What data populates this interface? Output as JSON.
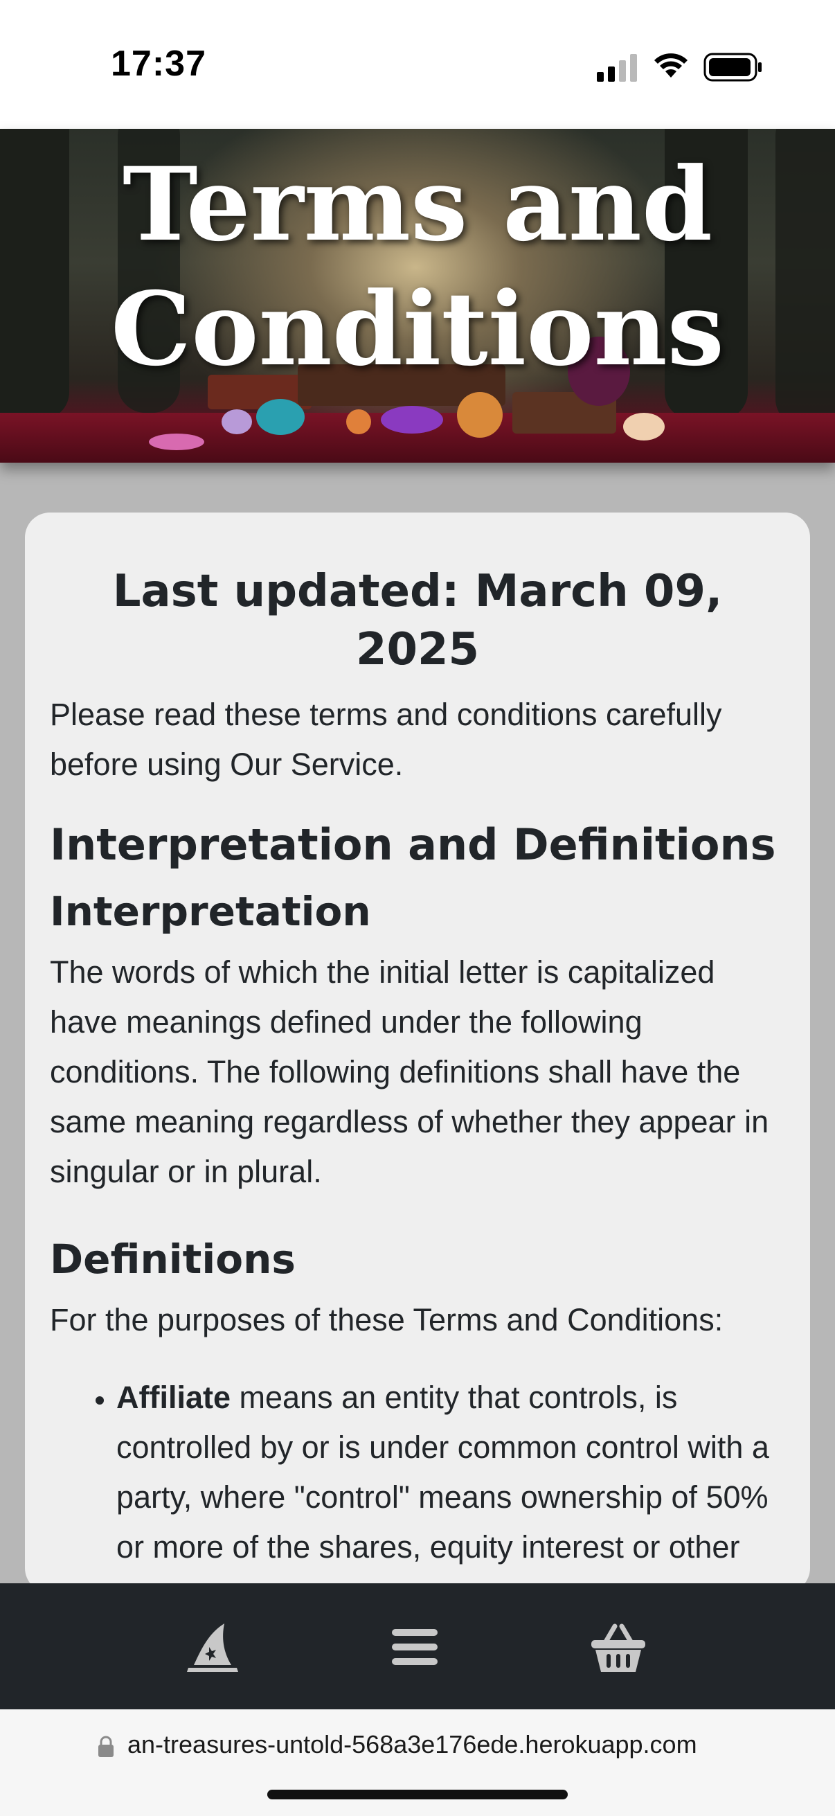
{
  "status": {
    "time": "17:37"
  },
  "hero": {
    "title_line1": "Terms and",
    "title_line2": "Conditions"
  },
  "content": {
    "last_updated": "Last updated: March 09, 2025",
    "intro": "Please read these terms and conditions carefully before using Our Service.",
    "section_heading": "Interpretation and Definitions",
    "interpretation_heading": "Interpretation",
    "interpretation_text": "The words of which the initial letter is capitalized have meanings defined under the following conditions. The following definitions shall have the same meaning regardless of whether they appear in singular or in plural.",
    "definitions_heading": "Definitions",
    "definitions_intro": "For the purposes of these Terms and Conditions:",
    "definitions": [
      {
        "term": "Affiliate",
        "text": " means an entity that controls, is controlled by or is under common control with a party, where \"control\" means ownership of 50% or more of the shares, equity interest or other securities entitled to"
      }
    ]
  },
  "nav": {
    "items": [
      {
        "icon": "wizard-hat-icon"
      },
      {
        "icon": "hamburger-menu-icon"
      },
      {
        "icon": "basket-icon"
      }
    ]
  },
  "browser": {
    "url": "an-treasures-untold-568a3e176ede.herokuapp.com"
  },
  "colors": {
    "nav_background": "#212529",
    "card_background": "#efefef",
    "page_background": "#b7b7b7"
  }
}
